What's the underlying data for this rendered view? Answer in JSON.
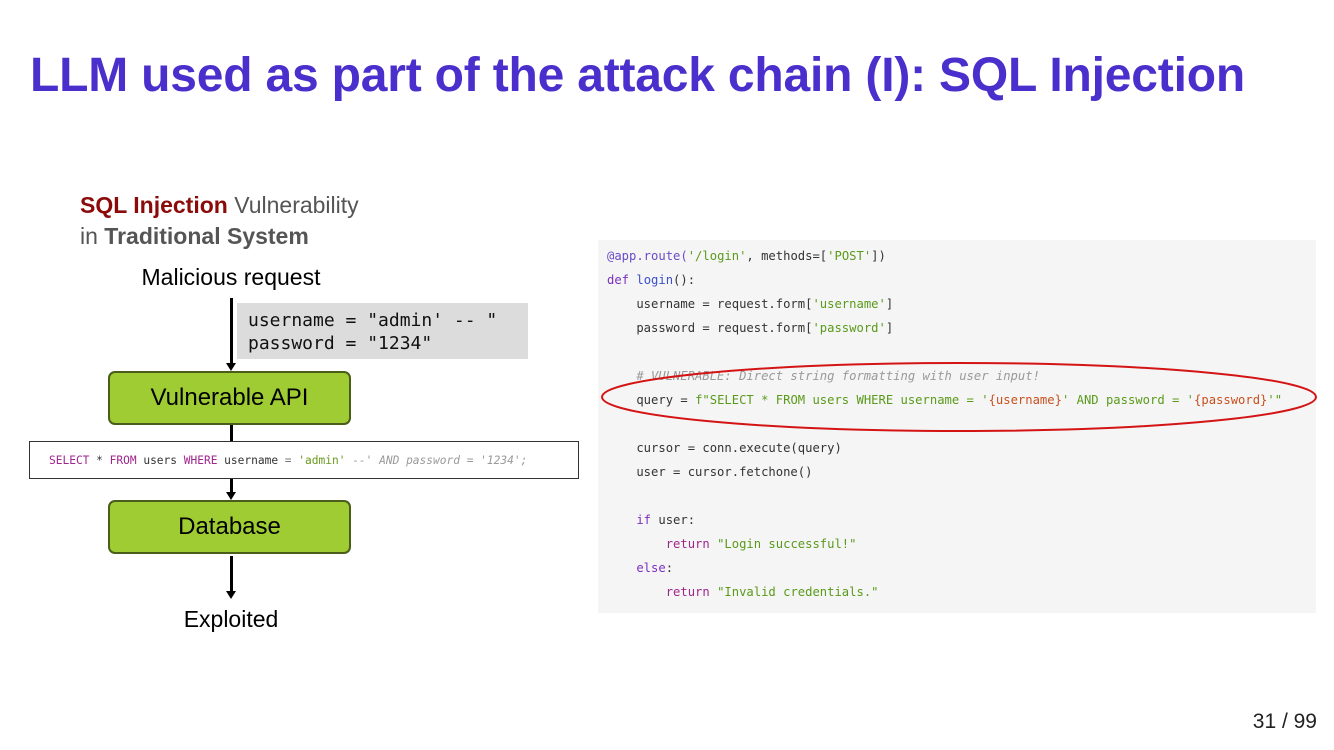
{
  "slide": {
    "title": "LLM used as part of the attack chain (I): SQL Injection",
    "page_number": "31 / 99"
  },
  "subtitle": {
    "part1_red": "SQL Injection",
    "part2": " Vulnerability",
    "part3": "in ",
    "part4_bold": "Traditional System"
  },
  "flow": {
    "top_label": "Malicious request",
    "input_line1": "username = \"admin' -- \"",
    "input_line2": "password = \"1234\"",
    "api_box": "Vulnerable API",
    "query": {
      "kw_select": "SELECT",
      "star": " * ",
      "kw_from": "FROM",
      "table": " users ",
      "kw_where": "WHERE",
      "col": " username ",
      "eq": "=",
      "space": " ",
      "val": "'admin'",
      "rest": " --' AND password = '1234';"
    },
    "db_box": "Database",
    "bottom_label": "Exploited"
  },
  "code": {
    "l1_deco": "@app.route(",
    "l1_str1": "'/login'",
    "l1_mid": ", methods=[",
    "l1_str2": "'POST'",
    "l1_end": "])",
    "l2_kw": "def",
    "l2_fn": " login",
    "l2_end": "():",
    "l3_a": "    username = request.form[",
    "l3_s": "'username'",
    "l3_e": "]",
    "l4_a": "    password = request.form[",
    "l4_s": "'password'",
    "l4_e": "]",
    "l5_cmt": "    # VULNERABLE: Direct string formatting with user input!",
    "l6_a": "    query = ",
    "l6_s1": "f\"SELECT * FROM users WHERE username = '",
    "l6_v1": "{username}",
    "l6_s2": "' AND password = '",
    "l6_v2": "{password}",
    "l6_s3": "'\"",
    "l7": "    cursor = conn.execute(query)",
    "l8": "    user = cursor.fetchone()",
    "l9_kw": "    if",
    "l9_e": " user:",
    "l10_kw": "        return",
    "l10_s": " \"Login successful!\"",
    "l11_kw": "    else",
    "l11_e": ":",
    "l12_kw": "        return",
    "l12_s": " \"Invalid credentials.\""
  },
  "colors": {
    "title": "#4a2fcc",
    "accent_red": "#8b0a0a",
    "box_green": "#9ecc32",
    "ellipse": "#d41414"
  }
}
